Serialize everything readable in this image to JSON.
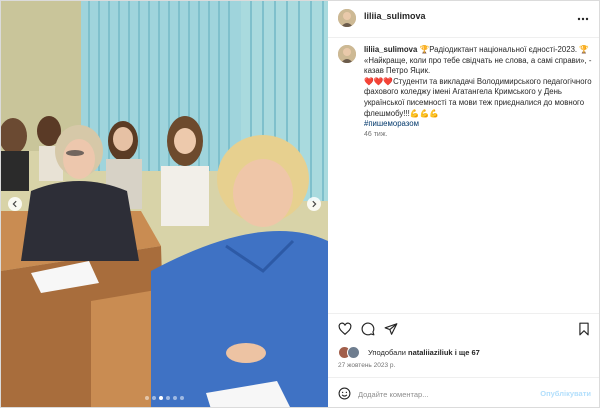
{
  "post": {
    "username": "liliia_sulimova",
    "caption": {
      "username": "liliia_sulimova",
      "line1": "🏆Радіодиктант національної єдності-2023. 🏆",
      "line2": "«Найкраще, коли про тебе свідчать не слова, а самі справи», - казав Петро Яцик.",
      "line3": "❤️❤️❤️Студенти та викладачі Володимирського педагогічного фахового коледжу імені Агатангела Кримського у День української писемності та мови теж приєдналися до мовного флешмобу!!!💪💪💪",
      "hashtag": "#пишеморазом",
      "time": "46 тиж."
    },
    "likes": {
      "prefix": "Уподобали",
      "user": "nataliiaziliuk",
      "suffix": "і ще 67"
    },
    "date": "27 жовтень 2023 р.",
    "comment": {
      "placeholder": "Додайте коментар...",
      "post_label": "Опублікувати"
    },
    "icons": {
      "more": "more-horizontal-icon",
      "like": "heart-icon",
      "comment": "comment-icon",
      "share": "share-icon",
      "save": "bookmark-icon",
      "emoji": "emoji-icon",
      "prev": "chevron-left-icon",
      "next": "chevron-right-icon"
    },
    "carousel": {
      "count": 6,
      "active_index": 2
    }
  }
}
